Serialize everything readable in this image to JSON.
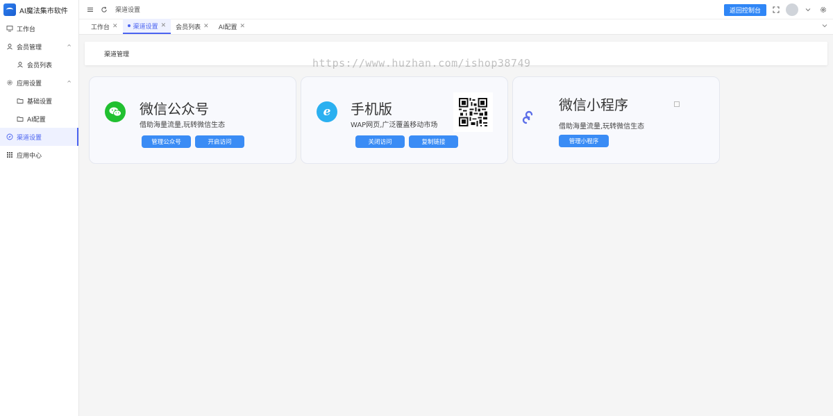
{
  "brand": {
    "title": "AI魔法集市软件"
  },
  "sidebar": {
    "items": [
      {
        "label": "工作台",
        "icon": "monitor-icon"
      },
      {
        "label": "会员管理",
        "icon": "user-icon",
        "expanded": true
      },
      {
        "label": "会员列表",
        "icon": "user-icon"
      },
      {
        "label": "应用设置",
        "icon": "gear-icon",
        "expanded": true
      },
      {
        "label": "基础设置",
        "icon": "folder-icon"
      },
      {
        "label": "AI配置",
        "icon": "folder-icon"
      },
      {
        "label": "渠道设置",
        "icon": "compass-icon",
        "active": true
      },
      {
        "label": "应用中心",
        "icon": "grid-icon"
      }
    ]
  },
  "header": {
    "breadcrumb": "渠道设置",
    "console_button": "返回控制台"
  },
  "tabs": [
    {
      "label": "工作台"
    },
    {
      "label": "渠道设置",
      "active": true
    },
    {
      "label": "会员列表"
    },
    {
      "label": "AI配置"
    }
  ],
  "panel": {
    "title": "渠道管理"
  },
  "watermark": "https://www.huzhan.com/ishop38749",
  "cards": {
    "wechat": {
      "title": "微信公众号",
      "subtitle": "借助海量流量,玩转微信生态",
      "buttons": [
        "管理公众号",
        "开启访问"
      ],
      "color": "#21c030"
    },
    "mobile": {
      "title": "手机版",
      "subtitle": "WAP网页,广泛覆盖移动市场",
      "buttons": [
        "关闭访问",
        "复制链接"
      ],
      "color": "#2bb0f0"
    },
    "miniprogram": {
      "title": "微信小程序",
      "subtitle": "借助海量流量,玩转微信生态",
      "buttons": [
        "管理小程序"
      ],
      "color": "#5b6ee8"
    }
  },
  "colors": {
    "accent": "#4a63f0",
    "button": "#3a8cf5"
  }
}
